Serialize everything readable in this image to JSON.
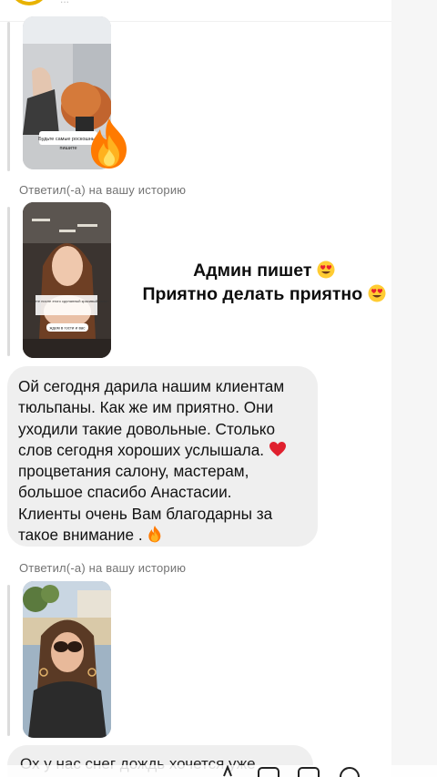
{
  "top": {
    "partial_text": "..."
  },
  "thread": {
    "story_reply_label_1": "Ответил(-а) на вашу историю",
    "story_reply_label_2": "Ответил(-а) на вашу историю"
  },
  "story1": {
    "caption_line1": "Будьте самые роскошные",
    "caption_line2": "пишите"
  },
  "story2": {
    "text_block": "Закажите после этого сделанный красивый салон",
    "chip": "ждем в гости и вас"
  },
  "overlay": {
    "line1": "Админ пишет",
    "line2": "Приятно делать приятно"
  },
  "message": {
    "lines": [
      "Ой  сегодня дарила нашим клиентам",
      "тюльпаны. Как же им приятно. Они",
      "уходили такие довольные. Столько",
      "слов сегодня хороших услышала.",
      "процветания салону, мастерам,",
      "большое спасибо Анастасии.",
      "Клиенты очень Вам благодарны за",
      "такое внимание ."
    ]
  },
  "next_message": {
    "partial": "Ох у нас снег дождь  хочется уже"
  },
  "colors": {
    "bubble": "#efefef",
    "label": "#737373",
    "heart": "#e0202e",
    "fire": "#ff7a00"
  },
  "icons": [
    "fire-emoji-icon",
    "heart-emoji-icon",
    "heart-eyes-emoji-icon",
    "camera-icon",
    "mic-icon",
    "gallery-icon",
    "sticker-icon"
  ]
}
